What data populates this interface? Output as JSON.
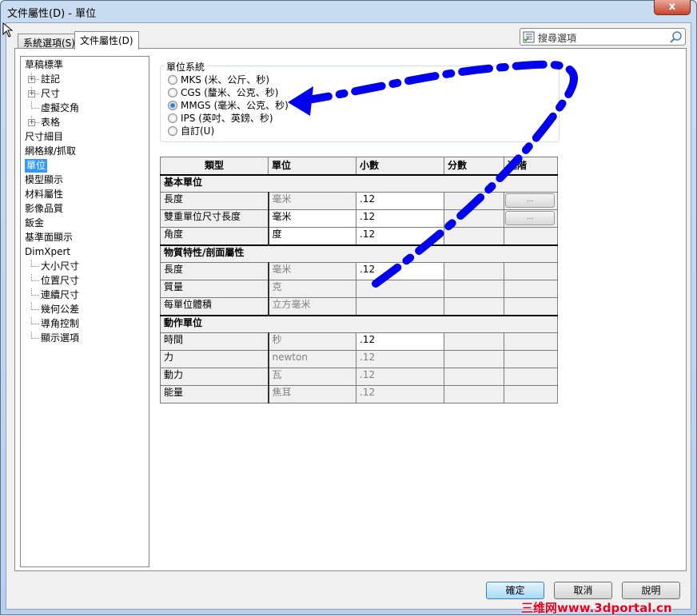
{
  "window": {
    "title": "文件屬性(D) - 單位",
    "close": "x"
  },
  "tabs": [
    {
      "label": "系統選項(S)"
    },
    {
      "label": "文件屬性(D)",
      "active": true
    }
  ],
  "search": {
    "placeholder": "搜尋選項"
  },
  "tree": [
    {
      "label": "草稿標準",
      "level": 0
    },
    {
      "label": "註記",
      "level": 1,
      "expand": true
    },
    {
      "label": "尺寸",
      "level": 1,
      "expand": true
    },
    {
      "label": "虛擬交角",
      "level": 1
    },
    {
      "label": "表格",
      "level": 1,
      "expand": true
    },
    {
      "label": "尺寸細目",
      "level": 0
    },
    {
      "label": "網格線/抓取",
      "level": 0
    },
    {
      "label": "單位",
      "level": 0,
      "selected": true
    },
    {
      "label": "模型顯示",
      "level": 0
    },
    {
      "label": "材料屬性",
      "level": 0
    },
    {
      "label": "影像品質",
      "level": 0
    },
    {
      "label": "鈑金",
      "level": 0
    },
    {
      "label": "基準面顯示",
      "level": 0
    },
    {
      "label": "DimXpert",
      "level": 0
    },
    {
      "label": "大小尺寸",
      "level": 1
    },
    {
      "label": "位置尺寸",
      "level": 1
    },
    {
      "label": "連續尺寸",
      "level": 1
    },
    {
      "label": "幾何公差",
      "level": 1
    },
    {
      "label": "導角控制",
      "level": 1
    },
    {
      "label": "顯示選項",
      "level": 1
    }
  ],
  "unit_system": {
    "label": "單位系統",
    "options": [
      {
        "label": "MKS  (米、公斤、秒)"
      },
      {
        "label": "CGS  (釐米、公克、秒)"
      },
      {
        "label": "MMGS (毫米、公克、秒)",
        "selected": true
      },
      {
        "label": "IPS  (英吋、英鎊、秒)"
      },
      {
        "label": "自訂(U)"
      }
    ]
  },
  "table": {
    "headers": [
      "類型",
      "單位",
      "小數",
      "分數",
      "進階"
    ],
    "rows": [
      {
        "section": "基本單位"
      },
      {
        "type": "長度",
        "unit": "毫米",
        "unit_enabled": false,
        "decimal": ".12",
        "decimal_enabled": true,
        "advanced": "..."
      },
      {
        "type": "雙重單位尺寸長度",
        "unit": "毫米",
        "unit_enabled": true,
        "decimal": ".12",
        "decimal_enabled": true,
        "advanced": "..."
      },
      {
        "type": "角度",
        "unit": "度",
        "unit_enabled": true,
        "decimal": ".12",
        "decimal_enabled": true
      },
      {
        "section": "物質特性/剖面屬性"
      },
      {
        "type": "長度",
        "unit": "毫米",
        "unit_enabled": false,
        "decimal": ".12",
        "decimal_enabled": true
      },
      {
        "type": "質量",
        "unit": "克",
        "unit_enabled": false,
        "decimal": ""
      },
      {
        "type": "每單位體積",
        "unit": "立方毫米",
        "unit_enabled": false,
        "decimal": ""
      },
      {
        "section": "動作單位"
      },
      {
        "type": "時間",
        "unit": "秒",
        "unit_enabled": false,
        "decimal": ".12",
        "decimal_enabled": true
      },
      {
        "type": "力",
        "unit": "newton",
        "unit_enabled": false,
        "decimal": ".12",
        "decimal_enabled": false
      },
      {
        "type": "動力",
        "unit": "瓦",
        "unit_enabled": false,
        "decimal": ".12",
        "decimal_enabled": false
      },
      {
        "type": "能量",
        "unit": "焦耳",
        "unit_enabled": false,
        "decimal": ".12",
        "decimal_enabled": false
      }
    ]
  },
  "buttons": {
    "ok": "確定",
    "cancel": "取消",
    "help": "說明"
  },
  "watermark": "三维网www.3dportal.cn",
  "colors": {
    "annotation": "#0000ee",
    "selection": "#3399ff",
    "watermark": "#e8001c"
  }
}
